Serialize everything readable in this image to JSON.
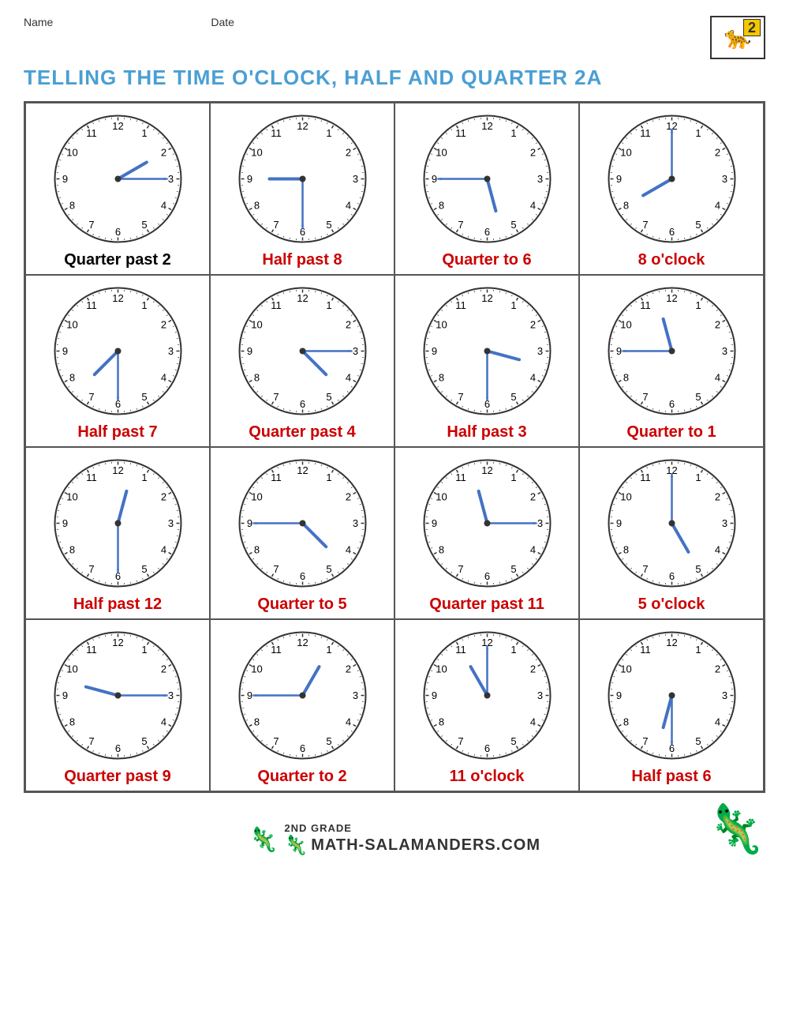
{
  "header": {
    "name_label": "Name",
    "date_label": "Date",
    "title": "TELLING THE TIME O'CLOCK, HALF AND QUARTER 2A",
    "logo_number": "2"
  },
  "clocks": [
    {
      "label": "Quarter past 2",
      "label_color": "black",
      "hour_angle": 60,
      "minute_angle": 90
    },
    {
      "label": "Half past 8",
      "label_color": "red",
      "hour_angle": 270,
      "minute_angle": 180
    },
    {
      "label": "Quarter to 6",
      "label_color": "red",
      "hour_angle": 165,
      "minute_angle": 270
    },
    {
      "label": "8 o'clock",
      "label_color": "red",
      "hour_angle": 240,
      "minute_angle": 0
    },
    {
      "label": "Half past 7",
      "label_color": "red",
      "hour_angle": 225,
      "minute_angle": 180
    },
    {
      "label": "Quarter past 4",
      "label_color": "red",
      "hour_angle": 135,
      "minute_angle": 90
    },
    {
      "label": "Half past 3",
      "label_color": "red",
      "hour_angle": 105,
      "minute_angle": 180
    },
    {
      "label": "Quarter to 1",
      "label_color": "red",
      "hour_angle": 345,
      "minute_angle": 270
    },
    {
      "label": "Half past 12",
      "label_color": "red",
      "hour_angle": 15,
      "minute_angle": 180
    },
    {
      "label": "Quarter to 5",
      "label_color": "red",
      "hour_angle": 135,
      "minute_angle": 270
    },
    {
      "label": "Quarter past 11",
      "label_color": "red",
      "hour_angle": 345,
      "minute_angle": 90
    },
    {
      "label": "5 o'clock",
      "label_color": "red",
      "hour_angle": 150,
      "minute_angle": 0
    },
    {
      "label": "Quarter past 9",
      "label_color": "red",
      "hour_angle": 285,
      "minute_angle": 90
    },
    {
      "label": "Quarter to 2",
      "label_color": "red",
      "hour_angle": 30,
      "minute_angle": 270
    },
    {
      "label": "11 o'clock",
      "label_color": "red",
      "hour_angle": 330,
      "minute_angle": 0
    },
    {
      "label": "Half past 6",
      "label_color": "red",
      "hour_angle": 195,
      "minute_angle": 180
    }
  ],
  "footer": {
    "grade": "2ND GRADE",
    "site": "ATH-SALAMANDERS.COM"
  }
}
